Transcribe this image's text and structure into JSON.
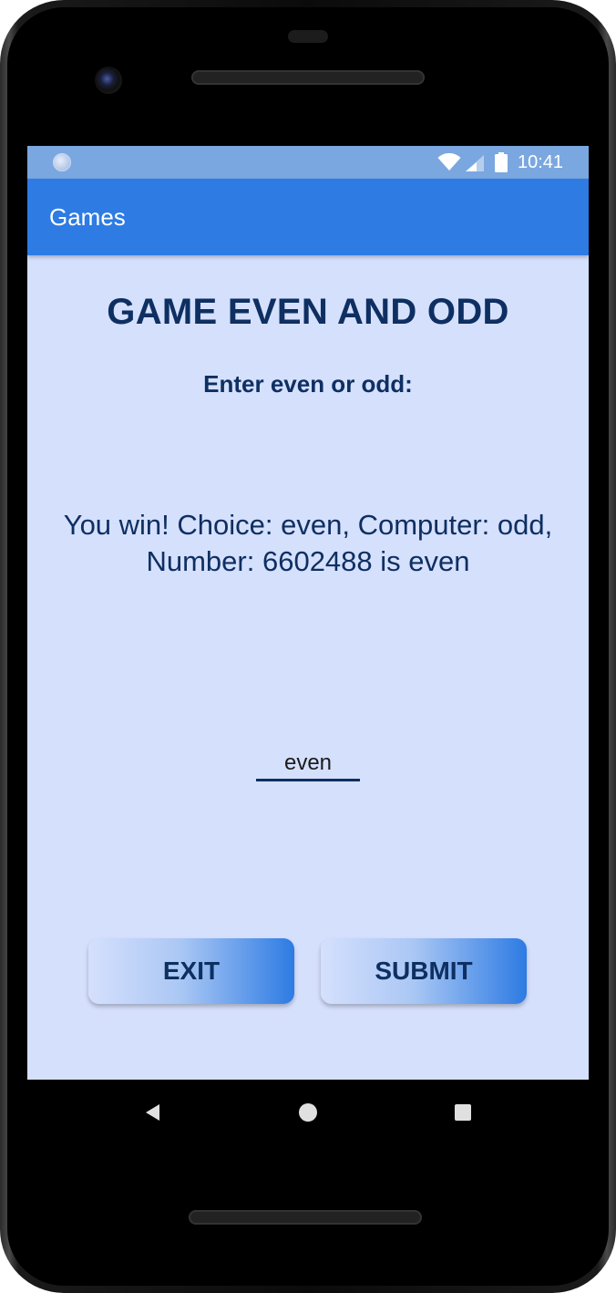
{
  "status_bar": {
    "time": "10:41",
    "icons": [
      "notification-dot-icon",
      "wifi-icon",
      "cell-signal-icon",
      "battery-icon"
    ]
  },
  "app_bar": {
    "title": "Games"
  },
  "game": {
    "title": "GAME EVEN AND ODD",
    "prompt": "Enter even or odd:",
    "result_line1": "You win! Choice: even, Computer: odd,",
    "result_line2": "Number: 6602488 is even",
    "input_value": "even"
  },
  "buttons": {
    "exit_label": "EXIT",
    "submit_label": "SUBMIT"
  },
  "nav_bar": {
    "icons": [
      "back-icon",
      "home-icon",
      "recents-icon"
    ]
  },
  "colors": {
    "status_bar": "#7ba7e0",
    "app_bar": "#2d7be3",
    "background": "#d5e0fd",
    "text_dark": "#0e2f61"
  }
}
